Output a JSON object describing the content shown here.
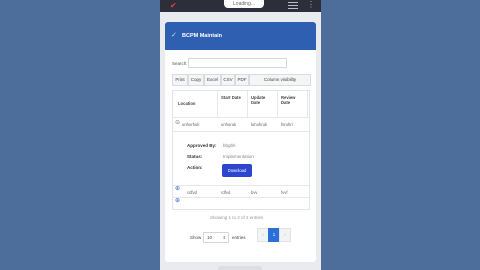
{
  "header": {
    "loading_text": "Loading..."
  },
  "card": {
    "title": "BCPM Maintain"
  },
  "search": {
    "label": "Search:",
    "placeholder": ""
  },
  "toolbar": [
    "Print",
    "Copy",
    "Excel",
    "CSV",
    "PDF",
    "Column visibility"
  ],
  "table": {
    "columns": [
      "Location",
      "Start Date",
      "Update Date",
      "Review Date"
    ],
    "row1": [
      "unhurhuk",
      "unhuruk",
      "luhuhruk",
      "hiruhri"
    ],
    "details": {
      "approved_by_label": "Approved By:",
      "approved_by_value": "bbgbh",
      "status_label": "Status:",
      "status_value": "Implementation",
      "action_label": "Action:",
      "action_button": "Download"
    },
    "row2": [
      "cdfvd",
      "rdfvd",
      "bvv",
      "fvvf"
    ]
  },
  "footer": {
    "info": "Showing 1 to 2 of 2 entries",
    "show_label": "Show",
    "entries_value": "10",
    "entries_label": "entries",
    "pages": [
      "‹",
      "1",
      "›"
    ]
  },
  "colors": {
    "accent": "#2e5fb1",
    "button": "#2c46d0",
    "background": "#4a6a9a"
  }
}
